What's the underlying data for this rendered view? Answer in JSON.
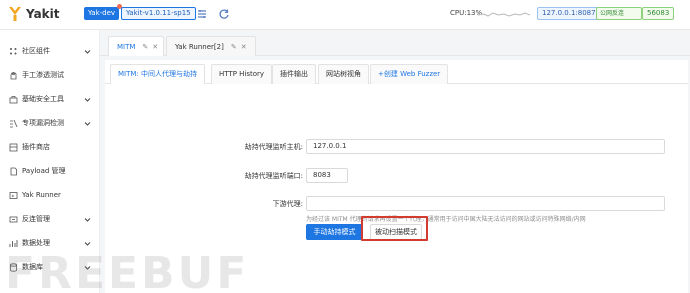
{
  "app": {
    "name": "Yakit",
    "env_tag": "Yak-dev",
    "version_tag": "Yakit-v1.0.11-sp15",
    "cpu": "CPU:13%",
    "ip": "127.0.0.1:8087",
    "net_status": "公网反连",
    "port": "56083"
  },
  "sidebar": {
    "items": [
      {
        "label": "社区组件",
        "icon": "grid-icon"
      },
      {
        "label": "手工渗透测试",
        "icon": "hand-icon"
      },
      {
        "label": "基础安全工具",
        "icon": "toolbox-icon"
      },
      {
        "label": "专项漏洞检测",
        "icon": "bug-scan-icon"
      },
      {
        "label": "插件商店",
        "icon": "store-icon"
      },
      {
        "label": "Payload 管理",
        "icon": "document-icon"
      },
      {
        "label": "Yak Runner",
        "icon": "code-icon"
      },
      {
        "label": "反连管理",
        "icon": "link-icon"
      },
      {
        "label": "数据处理",
        "icon": "data-icon"
      },
      {
        "label": "数据库",
        "icon": "database-icon"
      }
    ]
  },
  "tabs": [
    {
      "label": "MITM"
    },
    {
      "label": "Yak Runner[2]"
    }
  ],
  "subtabs": [
    {
      "label": "MITM: 中间人代理与劫持"
    },
    {
      "label": "HTTP History"
    },
    {
      "label": "插件输出"
    },
    {
      "label": "网站树视角"
    },
    {
      "label": "+创建 Web Fuzzer"
    }
  ],
  "form": {
    "host_label": "劫持代理监听主机:",
    "host_value": "127.0.0.1",
    "port_label": "劫持代理监听端口:",
    "port_value": "8083",
    "downstream_label": "下游代理:",
    "downstream_value": "",
    "downstream_hint": "为经过该 MITM 代理的请求再设置一个代理，通常用于访问中国大陆无法访问的网站或访问特殊网络/内网",
    "manual_button": "手动劫持模式",
    "passive_button": "被动扫描模式"
  },
  "watermark": "FREEBUF",
  "colors": {
    "accent": "#1e76e2",
    "highlight": "#d23b2e",
    "logo": "#f5a623"
  }
}
